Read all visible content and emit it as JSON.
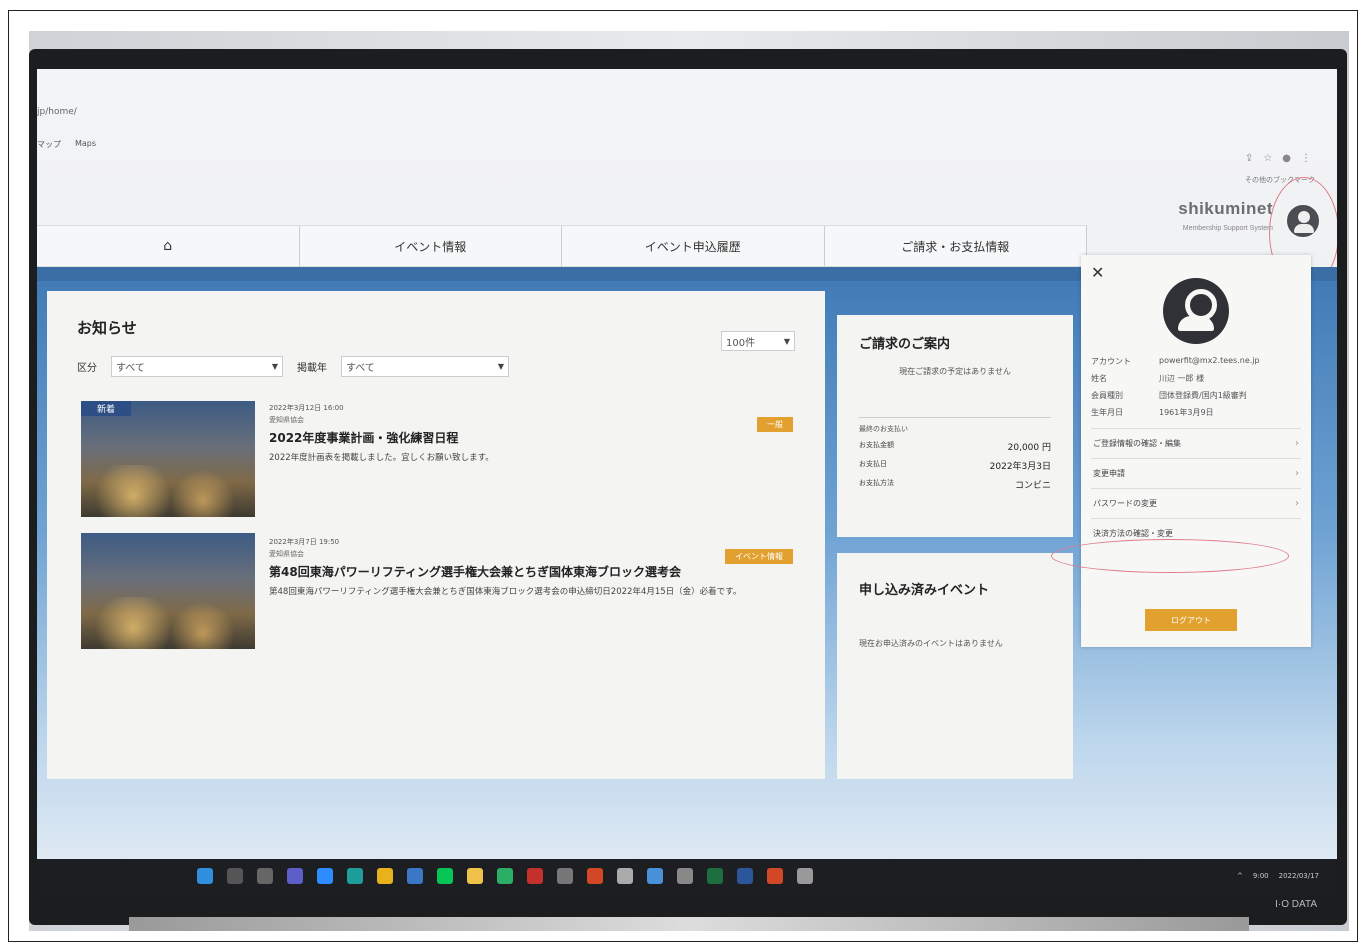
{
  "browser": {
    "url": "jp/home/",
    "bookmarks": [
      "マップ",
      "Maps"
    ],
    "bookmark_right": "その他のブックマーク"
  },
  "header": {
    "logo": "shikuminet",
    "logo_sub": "Membership Support System"
  },
  "nav": {
    "items": [
      "イベント情報",
      "イベント申込履歴",
      "ご請求・お支払情報"
    ]
  },
  "news": {
    "title": "お知らせ",
    "filter_category_label": "区分",
    "filter_category_value": "すべて",
    "filter_year_label": "掲載年",
    "filter_year_value": "すべて",
    "count_value": "100件",
    "articles": [
      {
        "badge": "新着",
        "date": "2022年3月12日 16:00",
        "org": "愛知県協会",
        "title": "2022年度事業計画・強化練習日程",
        "desc": "2022年度計画表を掲載しました。宜しくお願い致します。",
        "tag": "一般"
      },
      {
        "badge": "",
        "date": "2022年3月7日 19:50",
        "org": "愛知県協会",
        "title": "第48回東海パワーリフティング選手権大会兼とちぎ国体東海ブロック選考会",
        "desc": "第48回東海パワーリフティング選手権大会兼とちぎ国体東海ブロック選考会の申込締切日2022年4月15日（金）必着です。",
        "tag": "イベント情報"
      }
    ]
  },
  "billing": {
    "title": "ご請求のご案内",
    "none_text": "現在ご請求の予定はありません",
    "last_label": "最終のお支払い",
    "amount_label": "お支払金額",
    "amount_value": "20,000 円",
    "date_label": "お支払日",
    "date_value": "2022年3月3日",
    "method_label": "お支払方法",
    "method_value": "コンビニ"
  },
  "events": {
    "title": "申し込み済みイベント",
    "none_text": "現在お申込済みのイベントはありません"
  },
  "profile": {
    "close": "✕",
    "account_label": "アカウント",
    "account_value": "powerfit@mx2.tees.ne.jp",
    "name_label": "姓名",
    "name_value": "川辺 一郎 様",
    "type_label": "会員種別",
    "type_value": "団体登録費/国内1級審判",
    "birth_label": "生年月日",
    "birth_value": "1961年3月9日",
    "menu": [
      "ご登録情報の確認・編集",
      "変更申請",
      "パスワードの変更",
      "決済方法の確認・変更"
    ],
    "logout": "ログアウト"
  },
  "taskbar": {
    "time": "9:00",
    "date": "2022/03/17",
    "brand": "I·O DATA"
  },
  "colors": {
    "nav_blue": "#3a6ea5",
    "accent_orange": "#e2a12f",
    "highlight_pink": "#e07a8a"
  }
}
